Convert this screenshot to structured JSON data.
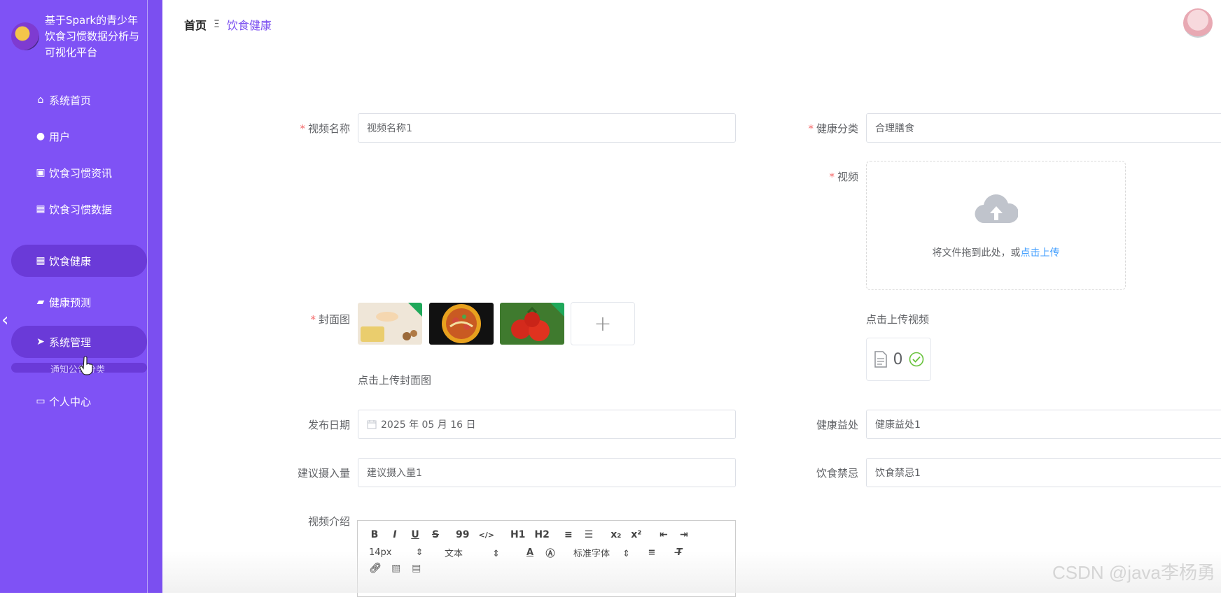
{
  "brand": {
    "title": "基于Spark的青少年饮食习惯数据分析与可视化平台"
  },
  "sidebar": {
    "items": [
      {
        "label": "系统首页",
        "icon": "home-icon"
      },
      {
        "label": "用户",
        "icon": "user-icon"
      },
      {
        "label": "饮食习惯资讯",
        "icon": "clipboard-icon"
      },
      {
        "label": "饮食习惯数据",
        "icon": "grid-icon"
      },
      {
        "label": "饮食健康",
        "icon": "grid-icon"
      },
      {
        "label": "健康预测",
        "icon": "wallet-icon"
      },
      {
        "label": "系统管理",
        "icon": "send-icon"
      },
      {
        "label": "个人中心",
        "icon": "card-icon"
      }
    ],
    "submenu_peek": "通知公告分类"
  },
  "header": {
    "breadcrumb_home": "首页",
    "breadcrumb_sep": "Ξ",
    "breadcrumb_current": "饮食健康"
  },
  "form": {
    "video_name": {
      "label": "视频名称",
      "value": "视频名称1"
    },
    "health_category": {
      "label": "健康分类",
      "value": "合理膳食"
    },
    "video": {
      "label": "视频",
      "drag_text": "将文件拖到此处，或",
      "click_upload": "点击上传",
      "tip": "点击上传视频",
      "file_count": "0"
    },
    "cover": {
      "label": "封面图",
      "tip": "点击上传封面图",
      "add_symbol": "+"
    },
    "publish_date": {
      "label": "发布日期",
      "value": "2025 年 05 月 16 日"
    },
    "health_benefit": {
      "label": "健康益处",
      "value": "健康益处1"
    },
    "suggested_intake": {
      "label": "建议摄入量",
      "value": "建议摄入量1"
    },
    "diet_taboo": {
      "label": "饮食禁忌",
      "value": "饮食禁忌1"
    },
    "video_intro": {
      "label": "视频介绍"
    }
  },
  "editor": {
    "row1": [
      "B",
      "I",
      "U",
      "S",
      "99",
      "</>",
      "H1",
      "H2",
      "≡",
      "☰",
      "x₂",
      "x²",
      "⇤",
      "⇥"
    ],
    "font_size": "14px",
    "block_type": "文本",
    "font_family": "标准字体"
  },
  "watermark": "CSDN @java李杨勇",
  "colors": {
    "sidebar": "#7f52f5",
    "active": "#6a3ad8",
    "accent": "#7b4ff0",
    "required": "#f56c6c",
    "link": "#409eff"
  }
}
